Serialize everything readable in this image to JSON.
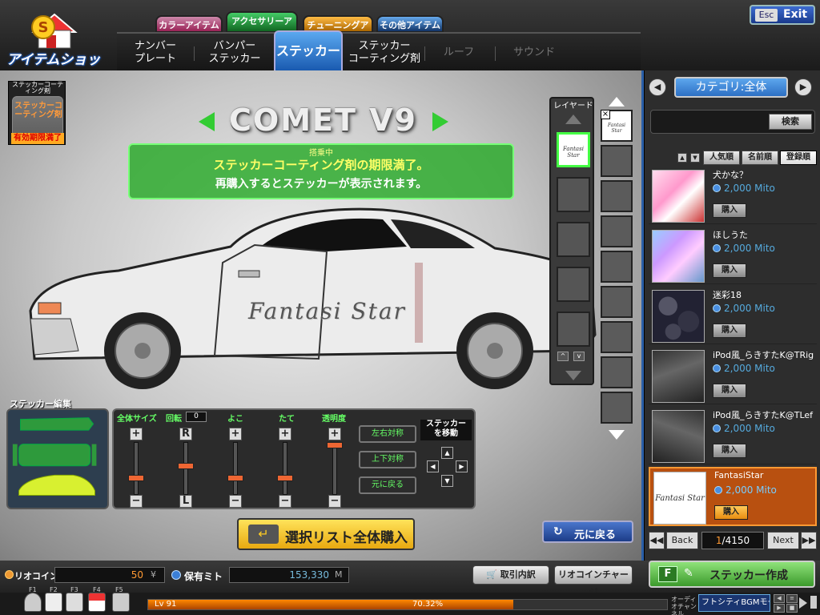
{
  "header": {
    "logo_text": "アイテムショップ",
    "top_tabs": [
      "カラーアイテム",
      "アクセサリーアイテム",
      "チューニングアイテム",
      "その他アイテム"
    ],
    "sub_tabs": [
      {
        "label": "ナンバー\nプレート",
        "active": false,
        "enabled": true
      },
      {
        "label": "バンパー\nステッカー",
        "active": false,
        "enabled": true
      },
      {
        "label": "ステッカー",
        "active": true,
        "enabled": true
      },
      {
        "label": "ステッカー\nコーティング剤",
        "active": false,
        "enabled": true
      },
      {
        "label": "ルーフ",
        "active": false,
        "enabled": false
      },
      {
        "label": "サウンド",
        "active": false,
        "enabled": false
      }
    ],
    "esc_key": "Esc",
    "exit_label": "Exit"
  },
  "coating_box": {
    "title": "ステッカーコーティング剤",
    "name": "ステッカーコーティング剤",
    "status": "有効期限満了"
  },
  "car": {
    "model": "COMET V9",
    "sticker_text": "Fantasi Star"
  },
  "message": {
    "tag": "搭乗中",
    "line1": "ステッカーコーティング剤の期限満了。",
    "line2": "再購入するとステッカーが表示されます。"
  },
  "layer_panel": {
    "title": "レイヤード",
    "selected_thumb_text": "Fantasi Star"
  },
  "sticker_edit": {
    "title": "ステッカー編集",
    "sliders": [
      {
        "label": "全体サイズ",
        "top": "+",
        "bottom": "−",
        "level": 0.3
      },
      {
        "label": "回転",
        "value": "0",
        "top": "R",
        "bottom": "L",
        "level": 0.55
      },
      {
        "label": "よこ",
        "top": "+",
        "bottom": "−",
        "level": 0.3
      },
      {
        "label": "たて",
        "top": "+",
        "bottom": "−",
        "level": 0.3
      },
      {
        "label": "透明度",
        "top": "+",
        "bottom": "−",
        "level": 1.0
      }
    ],
    "mirror_lr": "左右対称",
    "mirror_ud": "上下対称",
    "reset": "元に戻る",
    "move_label": "ステッカー\nを移動"
  },
  "actions": {
    "buy_all": "選択リスト全体購入",
    "revert": "元に戻る"
  },
  "status": {
    "rio_coin_label": "リオコイン",
    "rio_coin_value": "50",
    "rio_coin_unit": "¥",
    "mito_label": "保有ミト",
    "mito_value": "153,330",
    "mito_unit": "M",
    "history_btn": "取引内訳",
    "charge_btn": "リオコインチャージ"
  },
  "footer": {
    "fkeys": [
      "F1",
      "F2",
      "F3",
      "F4",
      "F5"
    ],
    "level": "Lv 91",
    "exp_pct": "70.32%",
    "exp_fraction": 0.7032,
    "audio_label": "オーディオチャンネル",
    "bgm": "フトシティBGMモード"
  },
  "right_panel": {
    "category": "カテゴリ:全体",
    "search_btn": "検索",
    "sort": [
      "人気順",
      "名前順",
      "登録順"
    ],
    "items": [
      {
        "name": "犬かな？",
        "price": "2,000 Mito",
        "buy": "購入",
        "selected": false,
        "thumb": "anime-girl-pink"
      },
      {
        "name": "ほしうた",
        "price": "2,000 Mito",
        "buy": "購入",
        "selected": false,
        "thumb": "anime-girls-blue"
      },
      {
        "name": "迷彩18",
        "price": "2,000 Mito",
        "buy": "購入",
        "selected": false,
        "thumb": "camo-dark"
      },
      {
        "name": "iPod風_らきすたK@TRig",
        "price": "2,000 Mito",
        "buy": "購入",
        "selected": false,
        "thumb": "sketch-girl"
      },
      {
        "name": "iPod風_らきすたK@TLef",
        "price": "2,000 Mito",
        "buy": "購入",
        "selected": false,
        "thumb": "sketch-girl"
      },
      {
        "name": "FantasiStar",
        "price": "2,000 Mito",
        "buy": "購入",
        "selected": true,
        "thumb": "fantasi-star-text",
        "thumb_text": "Fantasi Star"
      }
    ],
    "pager": {
      "back": "Back",
      "next": "Next",
      "page": "1",
      "total": "4150"
    },
    "create_key": "F",
    "create_label": "ステッカー作成"
  }
}
